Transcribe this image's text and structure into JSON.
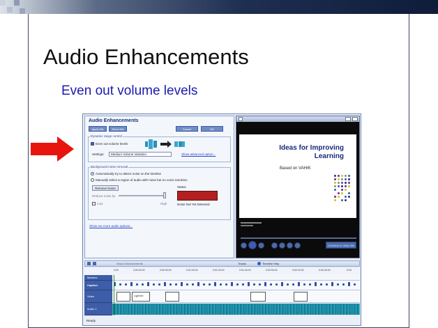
{
  "slide": {
    "title": "Audio Enhancements",
    "subtitle": "Even out volume levels"
  },
  "colors": {
    "title_text": "#111111",
    "subtitle_text": "#1a1ab0",
    "arrow": "#e8140e",
    "red_status": "#b32020"
  },
  "dialog": {
    "title": "Audio Enhancements",
    "buttons": [
      "Apply Mix",
      "Show Mix",
      "Cancel",
      "OK"
    ],
    "dynamic_group_label": "Dynamic range control",
    "even_out_label": "Even out volume levels",
    "settings_label": "Settings:",
    "settings_value": "Medium Volume Variation",
    "show_advanced": "Show advanced option...",
    "noise_group_label": "Background noise removal",
    "auto_detect_label": "Automatically try to detect noise on the timeline",
    "manual_label": "Manually select a region of audio with noise but no voice narration",
    "remove_noise_button": "Remove Noise",
    "status_label": "Status",
    "status_value": "Noise Not Yet Detected",
    "reduction_label": "Reduce noise by",
    "slider_min": "Low",
    "slider_max": "High",
    "more_options": "Show me more audio options..."
  },
  "preview": {
    "slide_title_line1": "Ideas for Improving",
    "slide_title_line2": "Learning",
    "slide_subtitle": "Based on VAHIK",
    "combine_button": "Combine to Video file"
  },
  "timeline": {
    "ruler_ticks": [
      "0:00",
      "0:00:20.00",
      "0:00:40.00",
      "0:01:00.00",
      "0:01:20.00",
      "0:01:40.00",
      "0:02:00.00",
      "0:02:20.00",
      "0:02:40.00",
      "0:03"
    ],
    "tracks": [
      "Markers",
      "Caption",
      "Video",
      "Audio 1"
    ],
    "clip_label": "Light the",
    "toolbar_labels": [
      "Show Enhancements",
      "Tracks",
      "Timeline Help"
    ],
    "status_bar": "Ready"
  }
}
